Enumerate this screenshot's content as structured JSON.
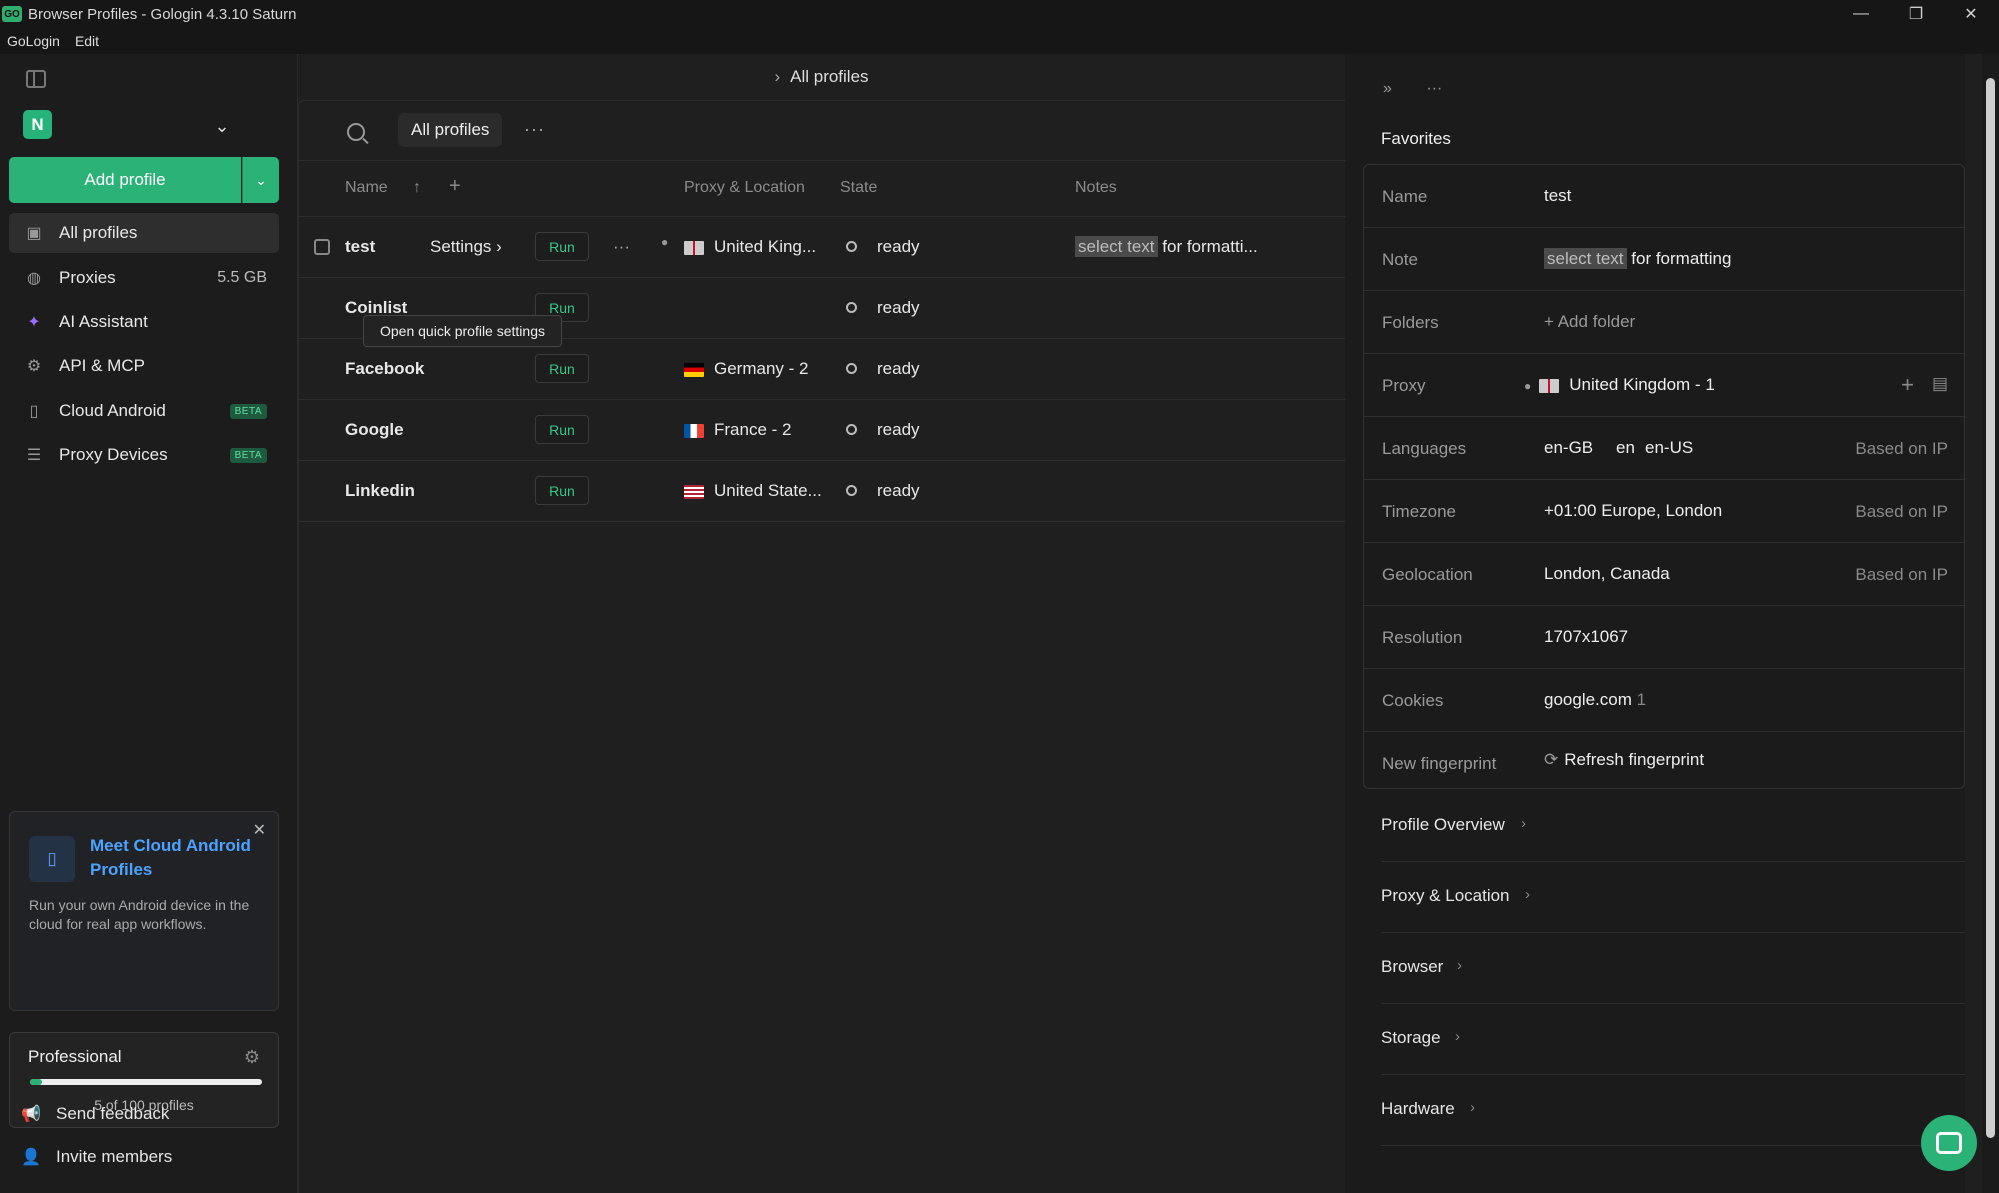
{
  "window": {
    "title": "Browser Profiles - Gologin 4.3.10 Saturn",
    "logo_text": "GO",
    "minimize": "—",
    "maximize": "❐",
    "close": "✕"
  },
  "menu": [
    "GoLogin",
    "Edit"
  ],
  "sidebar": {
    "workspace_initial": "N",
    "add_profile": "Add profile",
    "nav": [
      {
        "label": "All profiles",
        "icon": "profiles-icon",
        "active": true
      },
      {
        "label": "Proxies",
        "icon": "globe-icon",
        "extra": "5.5 GB"
      },
      {
        "label": "AI Assistant",
        "icon": "sparkle-icon"
      },
      {
        "label": "API & MCP",
        "icon": "api-icon"
      },
      {
        "label": "Cloud Android",
        "icon": "phone-icon",
        "badge": "BETA"
      },
      {
        "label": "Proxy Devices",
        "icon": "server-icon",
        "badge": "BETA"
      }
    ],
    "promo": {
      "title": "Meet Cloud Android Profiles",
      "desc": "Run your own Android device in the cloud for real app workflows."
    },
    "plan": {
      "name": "Professional",
      "count": "5 of 100 profiles",
      "used": 5,
      "total": 100
    },
    "footer": [
      {
        "label": "Send feedback",
        "icon": "megaphone-icon"
      },
      {
        "label": "Invite members",
        "icon": "user-plus-icon"
      }
    ]
  },
  "breadcrumb": "All profiles",
  "toolbar": {
    "tab": "All profiles",
    "more": "···"
  },
  "table": {
    "headers": {
      "name": "Name",
      "proxy": "Proxy & Location",
      "state": "State",
      "notes": "Notes"
    },
    "settings_label": "Settings",
    "run_label": "Run",
    "tooltip": "Open quick profile settings",
    "rows": [
      {
        "name": "test",
        "proxy": "United King...",
        "flag": "uk",
        "state": "ready",
        "note_hl": "select text",
        "note": " for formatti..."
      },
      {
        "name": "Coinlist",
        "proxy": "",
        "flag": "",
        "state": "ready",
        "note_hl": "",
        "note": ""
      },
      {
        "name": "Facebook",
        "proxy": "Germany - 2",
        "flag": "de",
        "state": "ready",
        "note_hl": "",
        "note": ""
      },
      {
        "name": "Google",
        "proxy": "France - 2",
        "flag": "fr",
        "state": "ready",
        "note_hl": "",
        "note": ""
      },
      {
        "name": "Linkedin",
        "proxy": "United State...",
        "flag": "us",
        "state": "ready",
        "note_hl": "",
        "note": ""
      }
    ]
  },
  "panel": {
    "favorites": "Favorites",
    "fields": {
      "name_label": "Name",
      "name_value": "test",
      "note_label": "Note",
      "note_hl": "select text",
      "note_value": " for formatting",
      "folders_label": "Folders",
      "folders_value": "Add folder",
      "proxy_label": "Proxy",
      "proxy_value": "United Kingdom - 1",
      "languages_label": "Languages",
      "languages": [
        "en-GB",
        "en",
        "en-US"
      ],
      "languages_right": "Based on IP",
      "timezone_label": "Timezone",
      "timezone_value": "+01:00 Europe, London",
      "timezone_right": "Based on IP",
      "geo_label": "Geolocation",
      "geo_value": "London, Canada",
      "geo_right": "Based on IP",
      "resolution_label": "Resolution",
      "resolution_value": "1707x1067",
      "cookies_label": "Cookies",
      "cookies_value": "google.com",
      "cookies_count": "1",
      "fp_label": "New fingerprint",
      "fp_value": "Refresh fingerprint"
    },
    "sections": [
      "Profile Overview",
      "Proxy & Location",
      "Browser",
      "Storage",
      "Hardware"
    ]
  },
  "colors": {
    "accent": "#2ab277",
    "link": "#4ba3ff",
    "run": "#35c786"
  }
}
